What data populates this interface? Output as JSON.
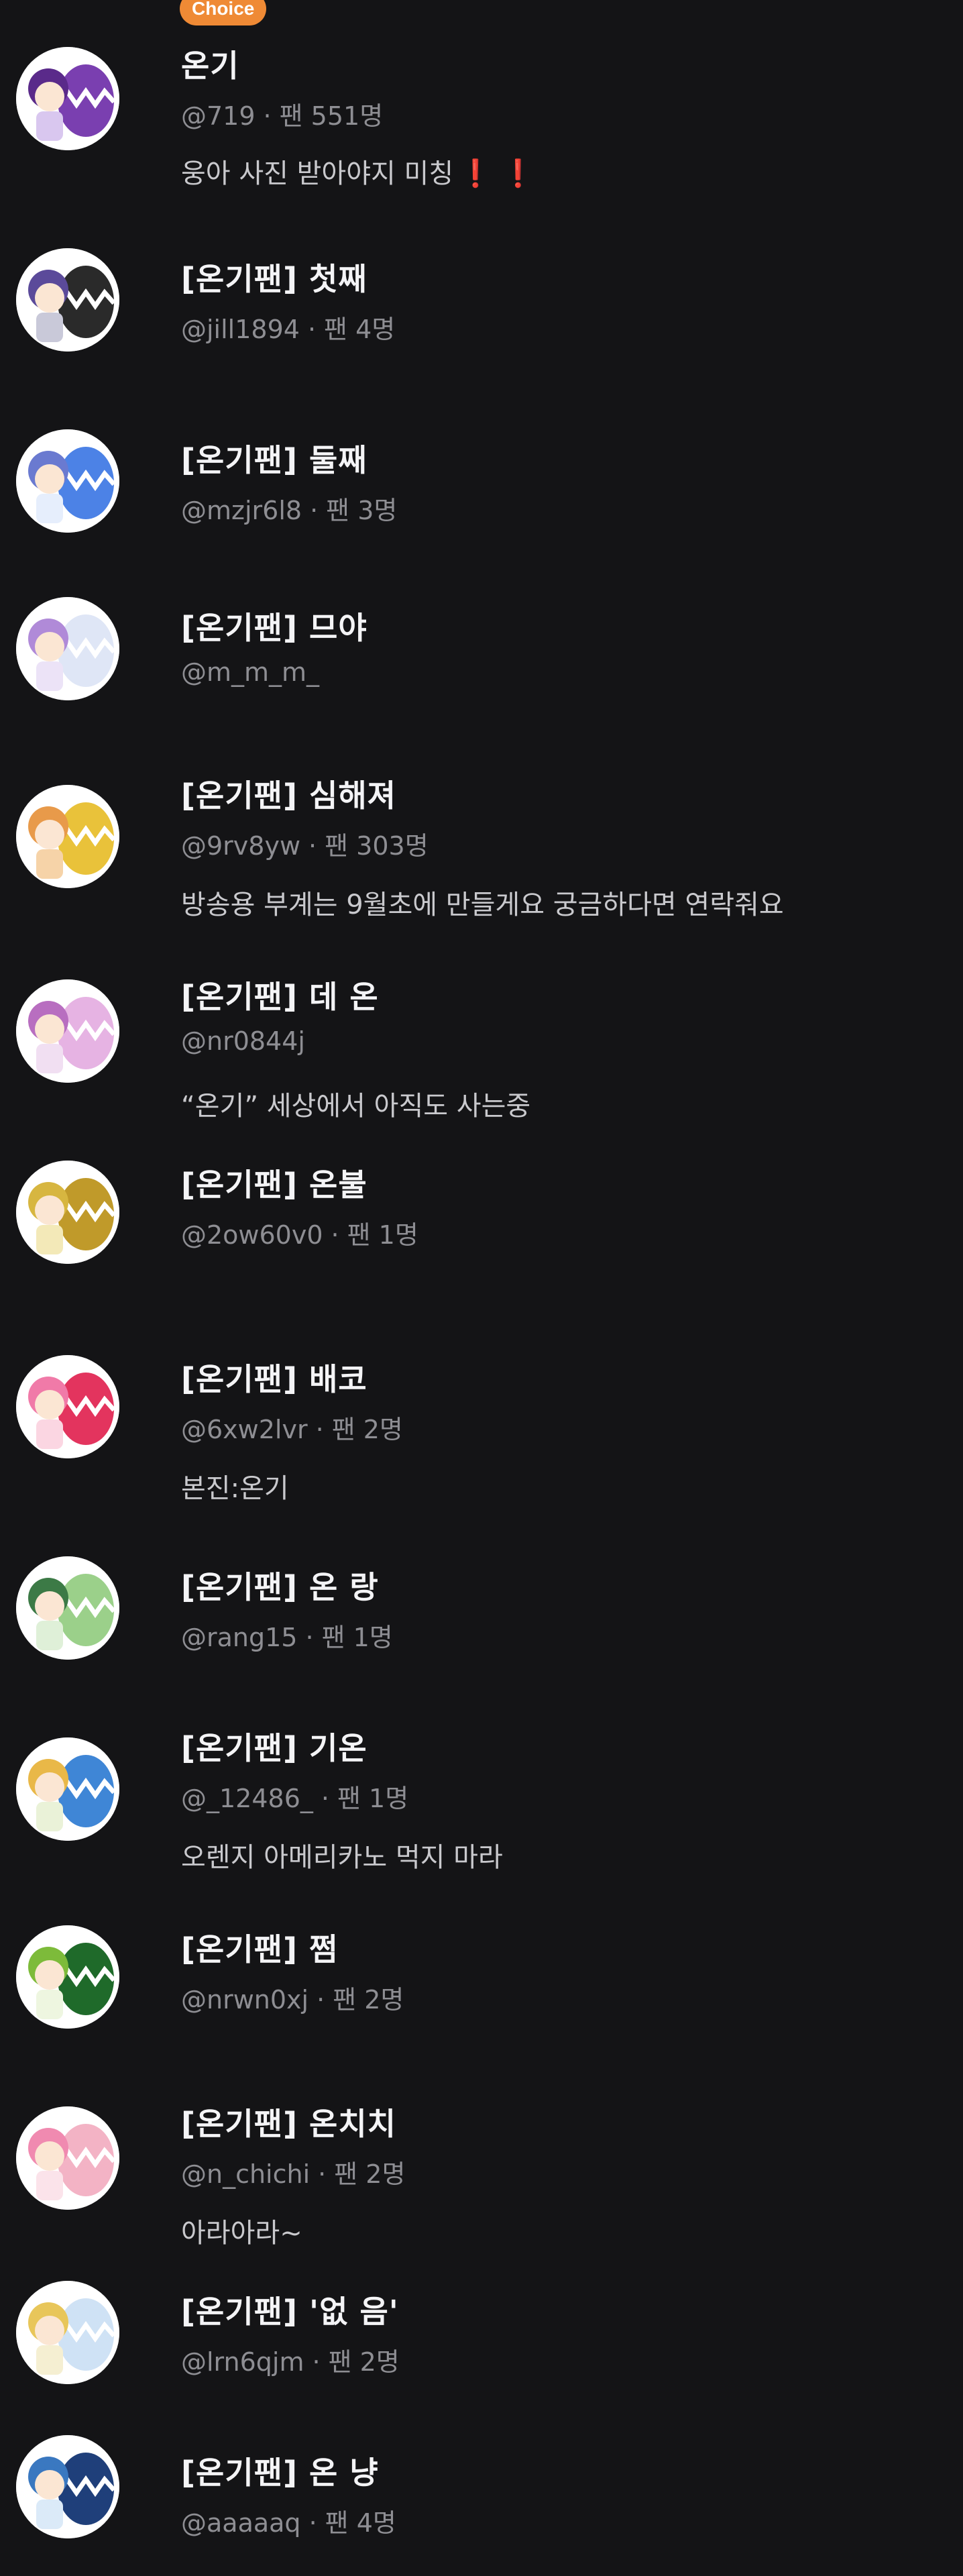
{
  "badge": "Choice",
  "users": [
    {
      "name": "온기",
      "handle": "@719",
      "fans": "팬 551명",
      "bio": "웅아 사진 받아야지 미칭",
      "bio_suffix": "❗ ❗",
      "avatar": {
        "c1": "#d9c7ef",
        "c2": "#7a3fb0",
        "hair": "#5a2a8a"
      }
    },
    {
      "name": "[온기팬] 첫째",
      "handle": "@jill1894",
      "fans": "팬 4명",
      "bio": "",
      "avatar": {
        "c1": "#c9c9d9",
        "c2": "#2a2a2a",
        "hair": "#5b4a9a"
      }
    },
    {
      "name": "[온기팬] 둘째",
      "handle": "@mzjr6l8",
      "fans": "팬 3명",
      "bio": "",
      "avatar": {
        "c1": "#e6eefc",
        "c2": "#4c82e6",
        "hair": "#6a7ad0"
      }
    },
    {
      "name": "[온기팬] 므야",
      "handle": "@m_m_m_",
      "fans": "",
      "bio": "",
      "avatar": {
        "c1": "#ece3f7",
        "c2": "#dfe6f6",
        "hair": "#b08ad8"
      }
    },
    {
      "name": "[온기팬] 심해져",
      "handle": "@9rv8yw",
      "fans": "팬 303명",
      "bio": "방송용 부계는 9월초에 만들게요 궁금하다면 연락줘요",
      "avatar": {
        "c1": "#f6d3a8",
        "c2": "#e9c23a",
        "hair": "#e89a4a"
      }
    },
    {
      "name": "[온기팬] 데 온",
      "handle": "@nr0844j",
      "fans": "",
      "bio": "“온기” 세상에서 아직도 사는중",
      "avatar": {
        "c1": "#f1dff2",
        "c2": "#e6b3e3",
        "hair": "#b86ec0"
      }
    },
    {
      "name": "[온기팬] 온불",
      "handle": "@2ow60v0",
      "fans": "팬 1명",
      "bio": "",
      "avatar": {
        "c1": "#f3e9b8",
        "c2": "#c09a2a",
        "hair": "#d7b640"
      }
    },
    {
      "name": "[온기팬] 배코",
      "handle": "@6xw2lvr",
      "fans": "팬 2명",
      "bio": "본진:온기",
      "avatar": {
        "c1": "#fbd6e2",
        "c2": "#e3345e",
        "hair": "#f07aa8"
      }
    },
    {
      "name": "[온기팬] 온 랑",
      "handle": "@rang15",
      "fans": "팬 1명",
      "bio": "",
      "avatar": {
        "c1": "#dff0d8",
        "c2": "#9bd08a",
        "hair": "#3c7a46"
      }
    },
    {
      "name": "[온기팬] 기온",
      "handle": "@_12486_",
      "fans": "팬 1명",
      "bio": "오렌지 아메리카노 먹지 마라",
      "avatar": {
        "c1": "#eaf2d8",
        "c2": "#3f86d6",
        "hair": "#e9b848"
      }
    },
    {
      "name": "[온기팬] 쩜",
      "handle": "@nrwn0xj",
      "fans": "팬 2명",
      "bio": "",
      "avatar": {
        "c1": "#eef6e0",
        "c2": "#1f6a2a",
        "hair": "#7dbb3a"
      }
    },
    {
      "name": "[온기팬] 온치치",
      "handle": "@n_chichi",
      "fans": "팬 2명",
      "bio": "아라아라~",
      "avatar": {
        "c1": "#fbe3ea",
        "c2": "#f3b3c5",
        "hair": "#f08ab0"
      }
    },
    {
      "name": "[온기팬] '없 음'",
      "handle": "@lrn6qjm",
      "fans": "팬 2명",
      "bio": "",
      "avatar": {
        "c1": "#f5efd2",
        "c2": "#cfe2f5",
        "hair": "#e8c65a"
      }
    },
    {
      "name": "[온기팬] 온 냥",
      "handle": "@aaaaaq",
      "fans": "팬 4명",
      "bio": "",
      "avatar": {
        "c1": "#dbeaf8",
        "c2": "#1f3f7a",
        "hair": "#3a78c0"
      }
    }
  ]
}
